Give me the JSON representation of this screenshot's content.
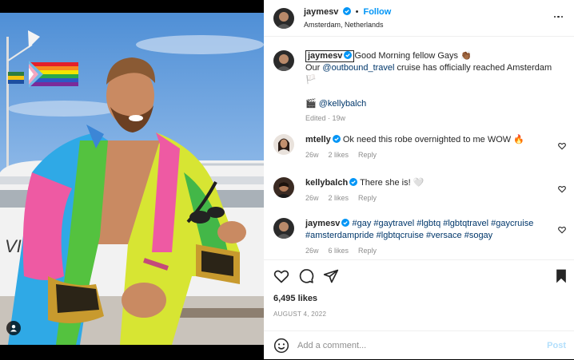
{
  "post": {
    "author": "jaymesv",
    "follow_label": "Follow",
    "location": "Amsterdam, Netherlands",
    "caption": {
      "line1": "Good Morning fellow Gays 👏🏾",
      "line2_prefix": "Our ",
      "line2_mention": "@outbound_travel",
      "line2_suffix": " cruise has officially reached Amsterdam",
      "line2_emoji": "🏳️",
      "credit_emoji": "🎬",
      "credit_mention": "@kellybalch",
      "edited": "Edited · 19w"
    },
    "likes": "6,495 likes",
    "date": "AUGUST 4, 2022"
  },
  "comments": [
    {
      "user": "mtelly",
      "text": "Ok need this robe overnighted to me WOW 🔥",
      "age": "26w",
      "likes": "2 likes",
      "reply": "Reply"
    },
    {
      "user": "kellybalch",
      "text": "There she is! 🤍",
      "age": "26w",
      "likes": "2 likes",
      "reply": "Reply"
    },
    {
      "user": "jaymesv",
      "text": "#gay #gaytravel #lgbtq #lgbtqtravel #gaycruise #amsterdampride #lgbtqcruise #versace #sogay",
      "age": "26w",
      "likes": "6 likes",
      "reply": "Reply"
    }
  ],
  "add_comment": {
    "placeholder": "Add a comment...",
    "post_label": "Post"
  },
  "icons": [
    "user-tag-icon",
    "verified-icon",
    "more-options-icon",
    "heart-icon",
    "comment-icon",
    "share-icon",
    "bookmark-icon",
    "emoji-icon"
  ],
  "colors": {
    "accent": "#0095f6",
    "link": "#00376b",
    "muted": "#8e8e8e",
    "post_disabled": "#b2dffc"
  }
}
